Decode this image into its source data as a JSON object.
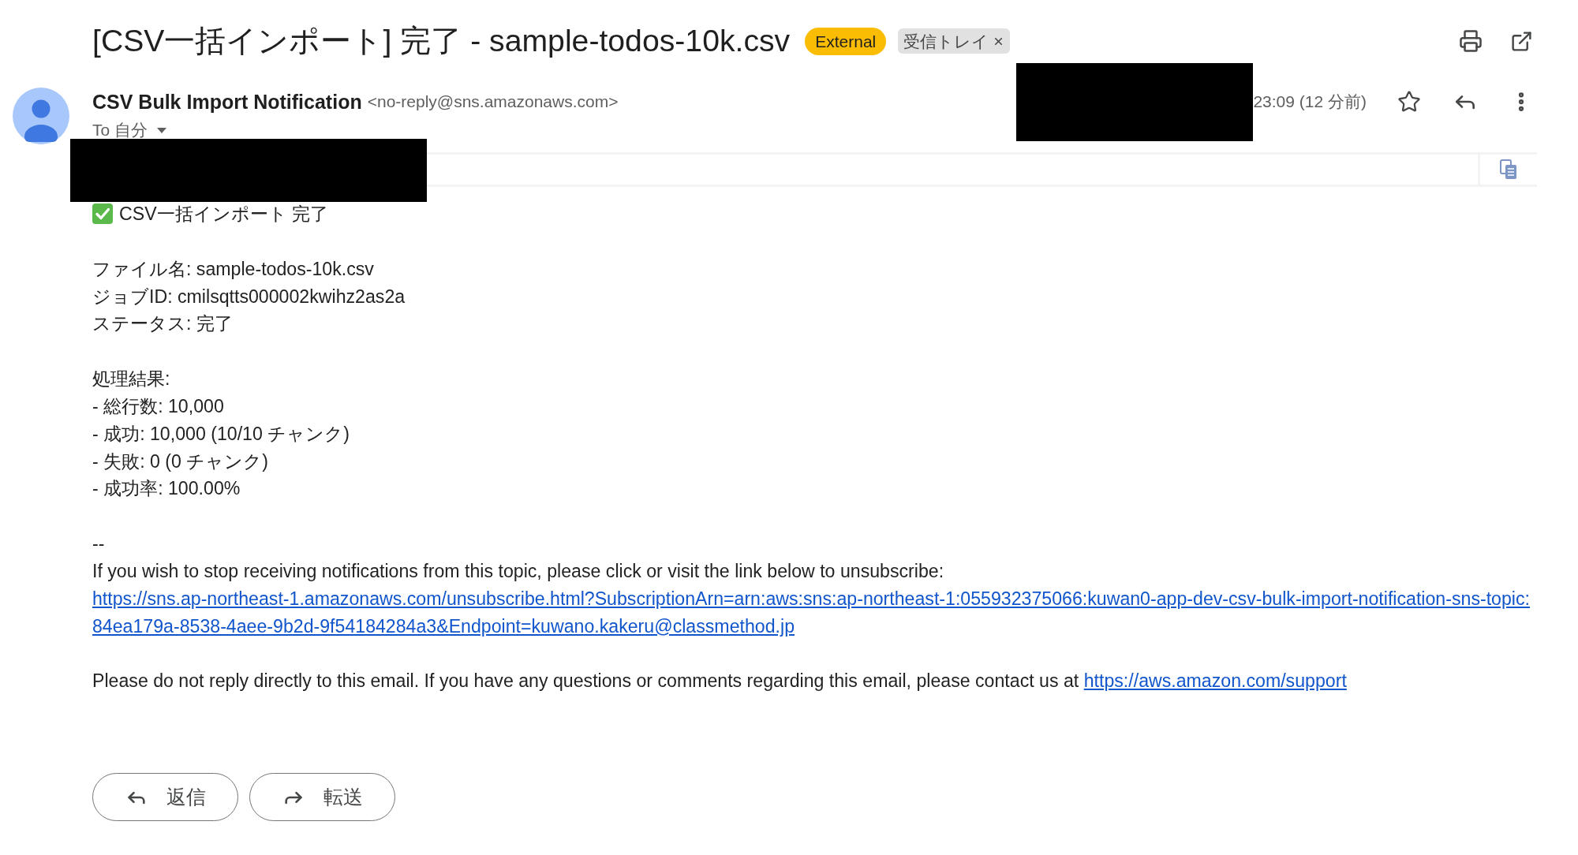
{
  "subject": "[CSV一括インポート] 完了 - sample-todos-10k.csv",
  "labels": [
    {
      "text": "External",
      "kind": "external",
      "removable": false
    },
    {
      "text": "受信トレイ",
      "kind": "folder",
      "removable": true
    }
  ],
  "sender": {
    "name": "CSV Bulk Import Notification",
    "address": "<no-reply@sns.amazonaws.com>",
    "recipient": "To 自分",
    "time": "23:09 (12 分前)",
    "starred": false
  },
  "body": {
    "heading": "CSV一括インポート 完了",
    "details": [
      "ファイル名: sample-todos-10k.csv",
      "ジョブID: cmilsqtts000002kwihz2as2a",
      "ステータス: 完了"
    ],
    "results_title": "処理結果:",
    "results": [
      "- 総行数: 10,000",
      "- 成功: 10,000 (10/10 チャンク)",
      "- 失敗: 0 (0 チャンク)",
      "- 成功率: 100.00%"
    ],
    "signature_separator": "--",
    "unsubscribe_text": "If you wish to stop receiving notifications from this topic, please click or visit the link below to unsubscribe:",
    "unsubscribe_link": "https://sns.ap-northeast-1.amazonaws.com/unsubscribe.html?SubscriptionArn=arn:aws:sns:ap-northeast-1:055932375066:kuwan0-app-dev-csv-bulk-import-notification-sns-topic:84ea179a-8538-4aee-9b2d-9f54184284a3&Endpoint=kuwano.kakeru@classmethod.jp",
    "footer": {
      "text": "Please do not reply directly to this email. If you have any questions or comments regarding this email, please contact us at",
      "link": "https://aws.amazon.com/support"
    }
  },
  "actions": [
    {
      "label": "返信",
      "kind": "reply"
    },
    {
      "label": "転送",
      "kind": "forward"
    }
  ]
}
